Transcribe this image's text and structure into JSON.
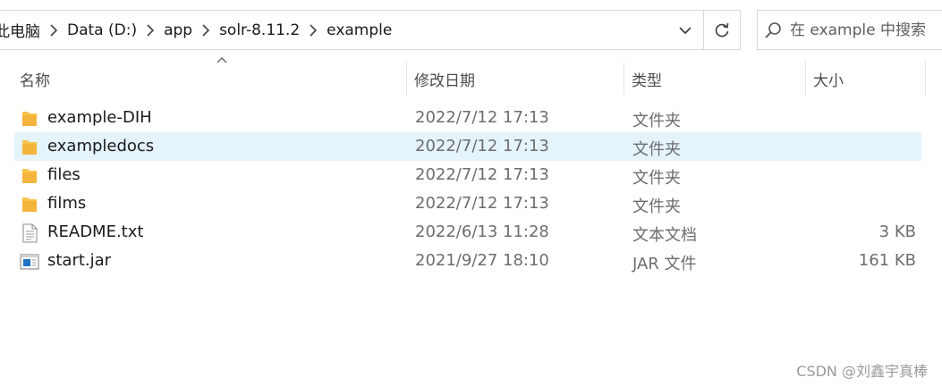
{
  "address_bar": {
    "crumbs": [
      "此电脑",
      "Data (D:)",
      "app",
      "solr-8.11.2",
      "example"
    ]
  },
  "search": {
    "placeholder": "在 example 中搜索"
  },
  "columns": {
    "name": "名称",
    "date": "修改日期",
    "type": "类型",
    "size": "大小"
  },
  "files": [
    {
      "name": "example-DIH",
      "date": "2022/7/12 17:13",
      "type": "文件夹",
      "size": "",
      "icon": "folder-icon"
    },
    {
      "name": "exampledocs",
      "date": "2022/7/12 17:13",
      "type": "文件夹",
      "size": "",
      "icon": "folder-icon",
      "selected": true
    },
    {
      "name": "files",
      "date": "2022/7/12 17:13",
      "type": "文件夹",
      "size": "",
      "icon": "folder-icon"
    },
    {
      "name": "films",
      "date": "2022/7/12 17:13",
      "type": "文件夹",
      "size": "",
      "icon": "folder-icon"
    },
    {
      "name": "README.txt",
      "date": "2022/6/13 11:28",
      "type": "文本文档",
      "size": "3 KB",
      "icon": "text-file-icon"
    },
    {
      "name": "start.jar",
      "date": "2021/9/27 18:10",
      "type": "JAR 文件",
      "size": "161 KB",
      "icon": "jar-file-icon"
    }
  ],
  "watermark": "CSDN @刘鑫宇真棒",
  "colors": {
    "selection": "#e5f3fb",
    "folder": "#f8c54a",
    "jar_blue": "#1e73c6"
  }
}
